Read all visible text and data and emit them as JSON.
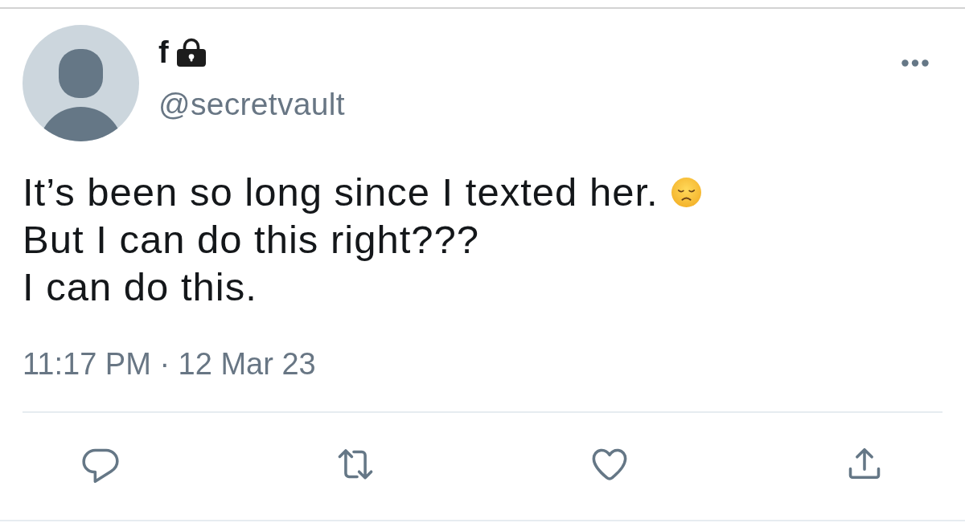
{
  "tweet": {
    "author": {
      "display_name": "f",
      "handle": "@secretvault"
    },
    "text_lines": [
      "It’s been so long since I texted her.",
      "But I can do this right???",
      "I can do this."
    ],
    "timestamp": "11:17 PM · 12 Mar 23"
  }
}
